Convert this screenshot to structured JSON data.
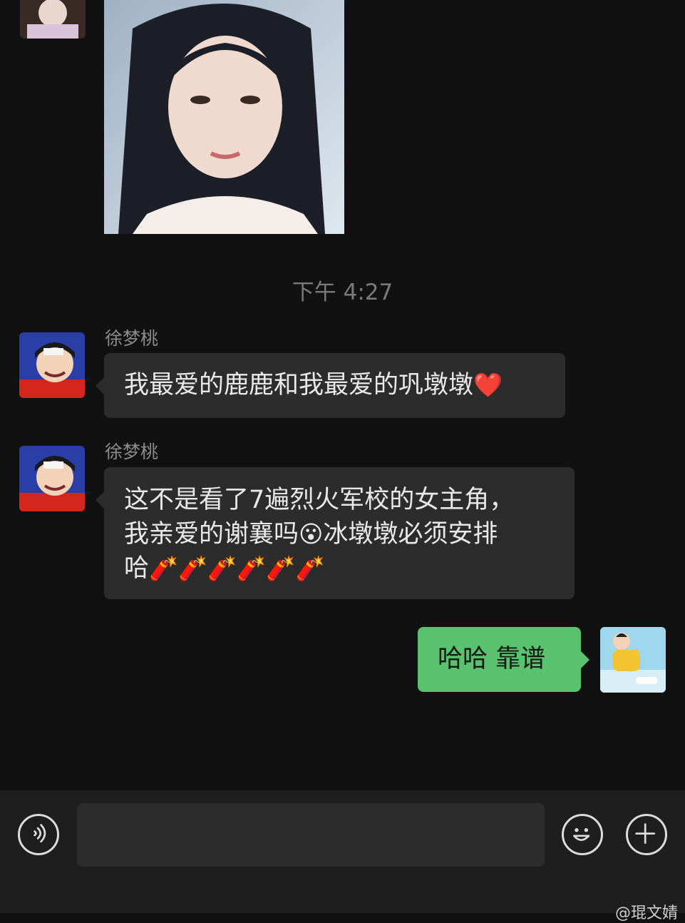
{
  "chat": {
    "timestamp": "下午 4:27",
    "messages": [
      {
        "sender": "徐梦桃",
        "text": "我最爱的鹿鹿和我最爱的巩墩墩",
        "emoji": "❤️"
      },
      {
        "sender": "徐梦桃",
        "line1": "这不是看了7遍烈火军校的女主角，",
        "line2a": "我亲爱的谢襄吗",
        "line2_emoji": "😮",
        "line2b": "冰墩墩必须安排",
        "line3": "哈",
        "line3_emoji": "🧨🧨🧨🧨🧨🧨"
      },
      {
        "text": "哈哈 靠谱"
      }
    ]
  },
  "input_bar": {
    "voice_icon": "voice-icon",
    "emoji_icon": "emoji-icon",
    "plus_icon": "plus-icon",
    "placeholder": ""
  },
  "watermark": "@琨文婧"
}
